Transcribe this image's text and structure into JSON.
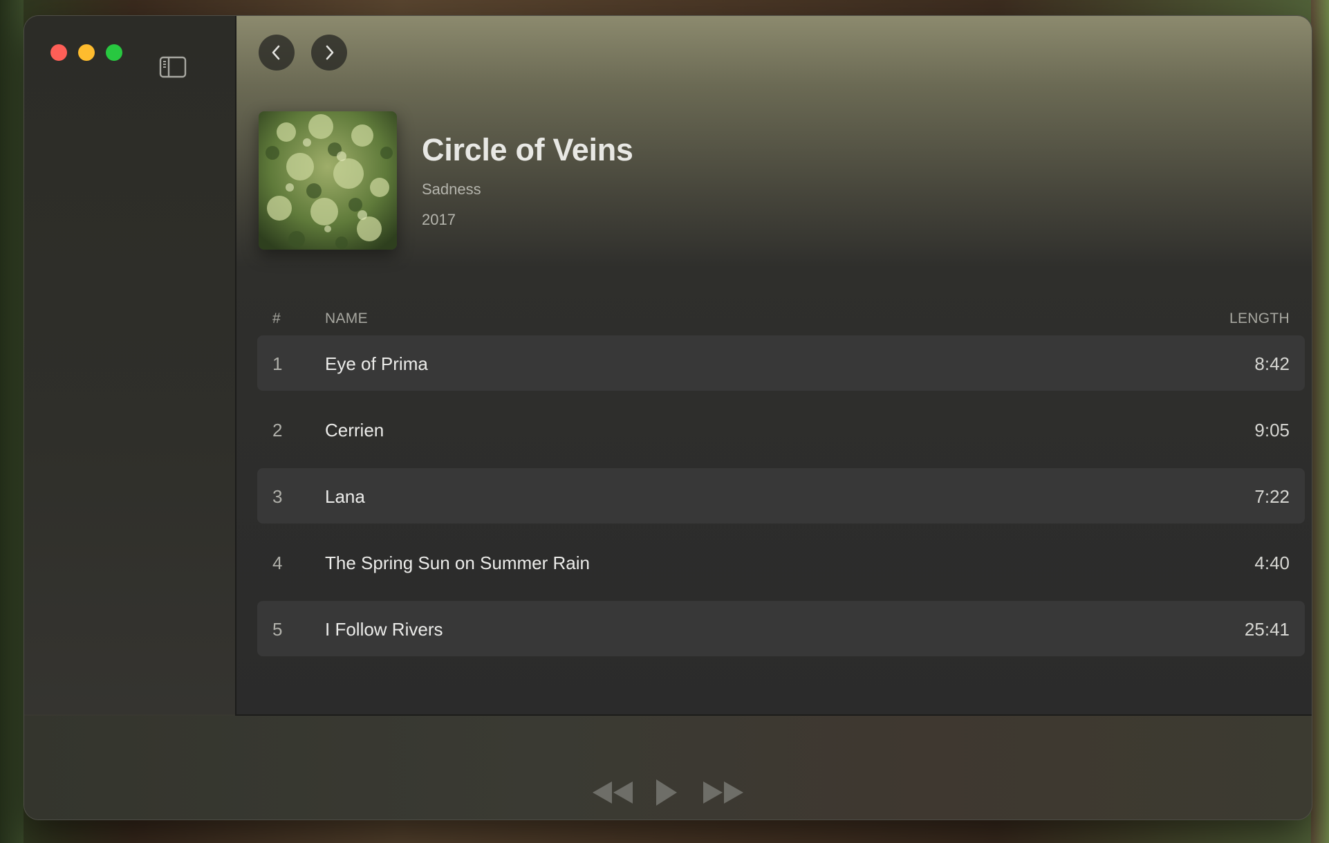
{
  "window": {
    "traffic_lights": [
      "close",
      "minimize",
      "maximize"
    ],
    "toolbar": {
      "sidebar_toggle_icon": "sidebar-left-icon",
      "back_icon": "chevron-left-icon",
      "forward_icon": "chevron-right-icon"
    }
  },
  "album": {
    "title": "Circle of Veins",
    "artist": "Sadness",
    "year": "2017"
  },
  "tracklist": {
    "columns": {
      "number": "#",
      "name": "NAME",
      "length": "LENGTH"
    },
    "tracks": [
      {
        "number": "1",
        "name": "Eye of Prima",
        "length": "8:42"
      },
      {
        "number": "2",
        "name": "Cerrien",
        "length": "9:05"
      },
      {
        "number": "3",
        "name": "Lana",
        "length": "7:22"
      },
      {
        "number": "4",
        "name": "The Spring Sun on Summer Rain",
        "length": "4:40"
      },
      {
        "number": "5",
        "name": "I Follow Rivers",
        "length": "25:41"
      }
    ]
  },
  "player": {
    "controls": [
      "rewind-icon",
      "play-icon",
      "fast-forward-icon"
    ]
  },
  "colors": {
    "close": "#fe5f57",
    "minimize": "#febc2e",
    "maximize": "#28c840",
    "row_alt": "#383838"
  }
}
